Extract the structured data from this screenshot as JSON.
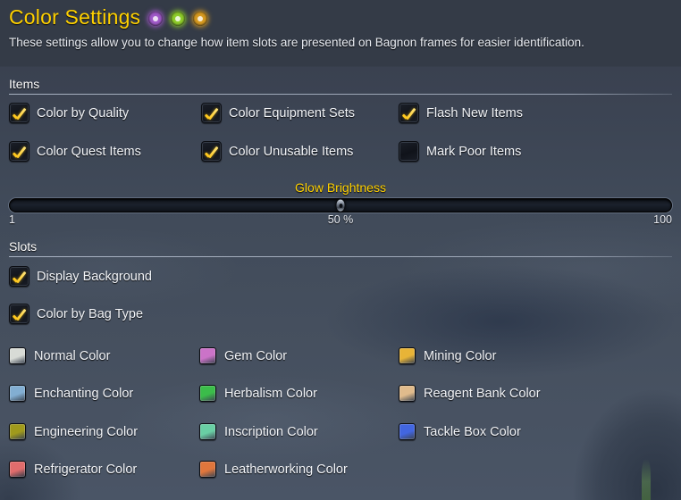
{
  "header": {
    "title": "Color Settings",
    "orbs": [
      {
        "name": "orb-purple",
        "color": "#a05ac8"
      },
      {
        "name": "orb-green",
        "color": "#8ecc2a"
      },
      {
        "name": "orb-gold",
        "color": "#d79a20"
      }
    ],
    "description": "These settings allow you to change how item slots are presented on Bagnon frames for easier identification."
  },
  "sections": {
    "items": {
      "label": "Items",
      "checkboxes": [
        {
          "label": "Color by Quality",
          "checked": true
        },
        {
          "label": "Color Equipment Sets",
          "checked": true
        },
        {
          "label": "Flash New Items",
          "checked": true
        },
        {
          "label": "Color Quest Items",
          "checked": true
        },
        {
          "label": "Color Unusable Items",
          "checked": true
        },
        {
          "label": "Mark Poor Items",
          "checked": false
        }
      ]
    },
    "slider": {
      "label": "Glow Brightness",
      "min_label": "1",
      "max_label": "100",
      "value_label": "50 %",
      "percent": 50
    },
    "slots": {
      "label": "Slots",
      "checkboxes": [
        {
          "label": "Display Background",
          "checked": true
        },
        {
          "label": "Color by Bag Type",
          "checked": true
        }
      ],
      "colors": [
        {
          "label": "Normal Color",
          "color": "#d8dbd6"
        },
        {
          "label": "Gem Color",
          "color": "#cb73c8"
        },
        {
          "label": "Mining Color",
          "color": "#e8b437"
        },
        {
          "label": "Enchanting Color",
          "color": "#82aed2"
        },
        {
          "label": "Herbalism Color",
          "color": "#3bbd4a"
        },
        {
          "label": "Reagent Bank Color",
          "color": "#e0bb8c"
        },
        {
          "label": "Engineering Color",
          "color": "#a09a1c"
        },
        {
          "label": "Inscription Color",
          "color": "#69cfa4"
        },
        {
          "label": "Tackle Box Color",
          "color": "#4266e0"
        },
        {
          "label": "Refrigerator Color",
          "color": "#e06c6c"
        },
        {
          "label": "Leatherworking Color",
          "color": "#e0763c"
        }
      ]
    }
  }
}
